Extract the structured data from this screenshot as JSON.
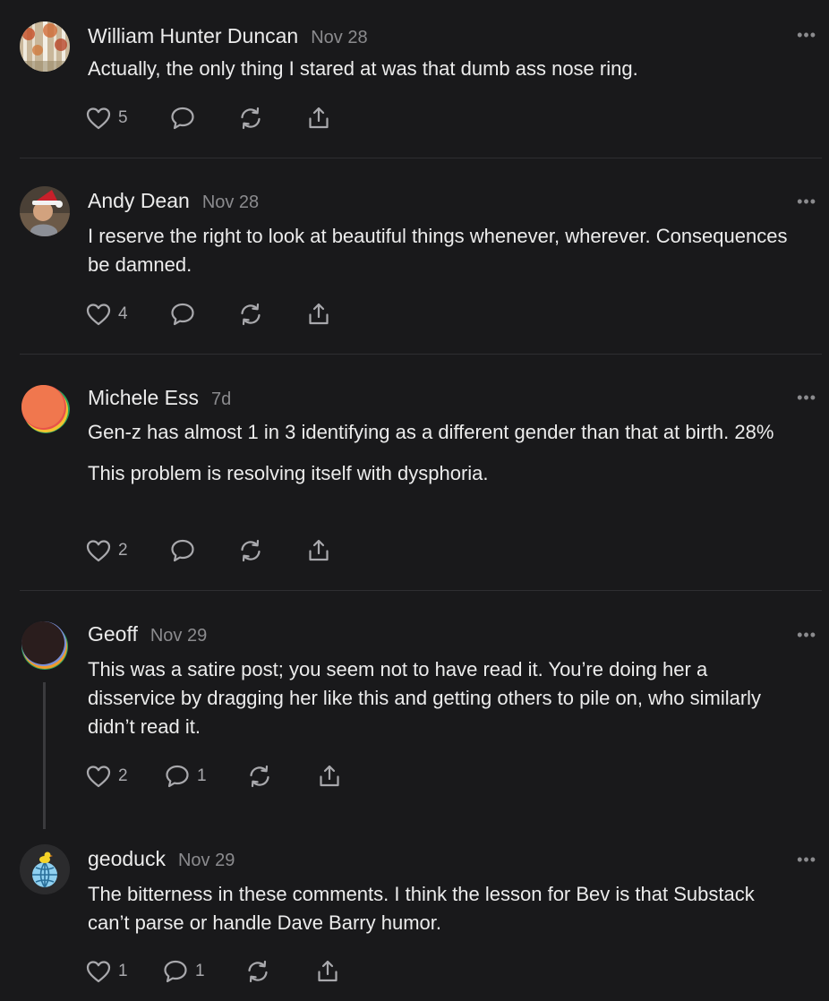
{
  "colors": {
    "background": "#19191b",
    "text": "#ececec",
    "muted": "#8b8b8e",
    "icon": "#a9a9ad",
    "divider": "#2e2e31"
  },
  "more_label": "•••",
  "comments": [
    {
      "author": "William Hunter Duncan",
      "date": "Nov 28",
      "paragraphs": [
        "Actually, the only thing I stared at was that dumb ass nose ring."
      ],
      "likes": "5",
      "replies": ""
    },
    {
      "author": "Andy Dean",
      "date": "Nov 28",
      "paragraphs": [
        "I reserve the right to look at beautiful things whenever, wherever. Consequences be damned."
      ],
      "likes": "4",
      "replies": ""
    },
    {
      "author": "Michele Ess",
      "date": "7d",
      "paragraphs": [
        "Gen-z has almost 1 in 3 identifying as a different gender than that at birth. 28%",
        "This problem is resolving itself with dysphoria."
      ],
      "likes": "2",
      "replies": ""
    },
    {
      "author": "Geoff",
      "date": "Nov 29",
      "paragraphs": [
        "This was a satire post; you seem not to have read it. You’re doing her a disservice by dragging her like this and getting others to pile on, who similarly didn’t read it."
      ],
      "likes": "2",
      "replies": "1"
    },
    {
      "author": "geoduck",
      "date": "Nov 29",
      "paragraphs": [
        "The bitterness in these comments. I think the lesson for Bev is that Substack can’t parse or handle Dave Barry humor."
      ],
      "likes": "1",
      "replies": "1"
    }
  ]
}
